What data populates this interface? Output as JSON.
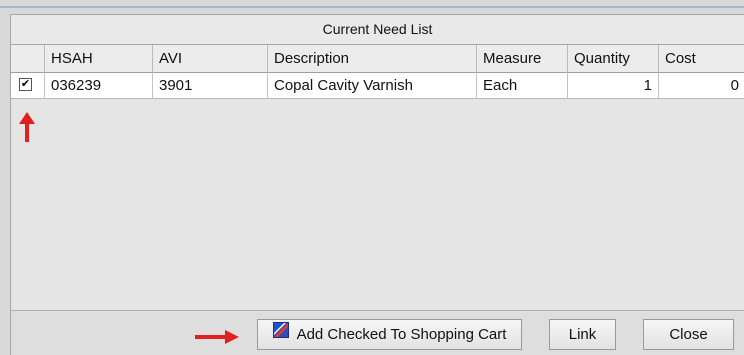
{
  "title": "Current Need List",
  "columns": [
    "HSAH",
    "AVI",
    "Description",
    "Measure",
    "Quantity",
    "Cost"
  ],
  "rows": [
    {
      "checked": "✔",
      "hsah": "036239",
      "avi": "3901",
      "description": "Copal Cavity Varnish",
      "measure": "Each",
      "quantity": "1",
      "cost": "0"
    }
  ],
  "buttons": {
    "add_to_cart": "Add Checked To Shopping Cart",
    "link": "Link",
    "close": "Close"
  },
  "annotation_color": "#e0201e"
}
